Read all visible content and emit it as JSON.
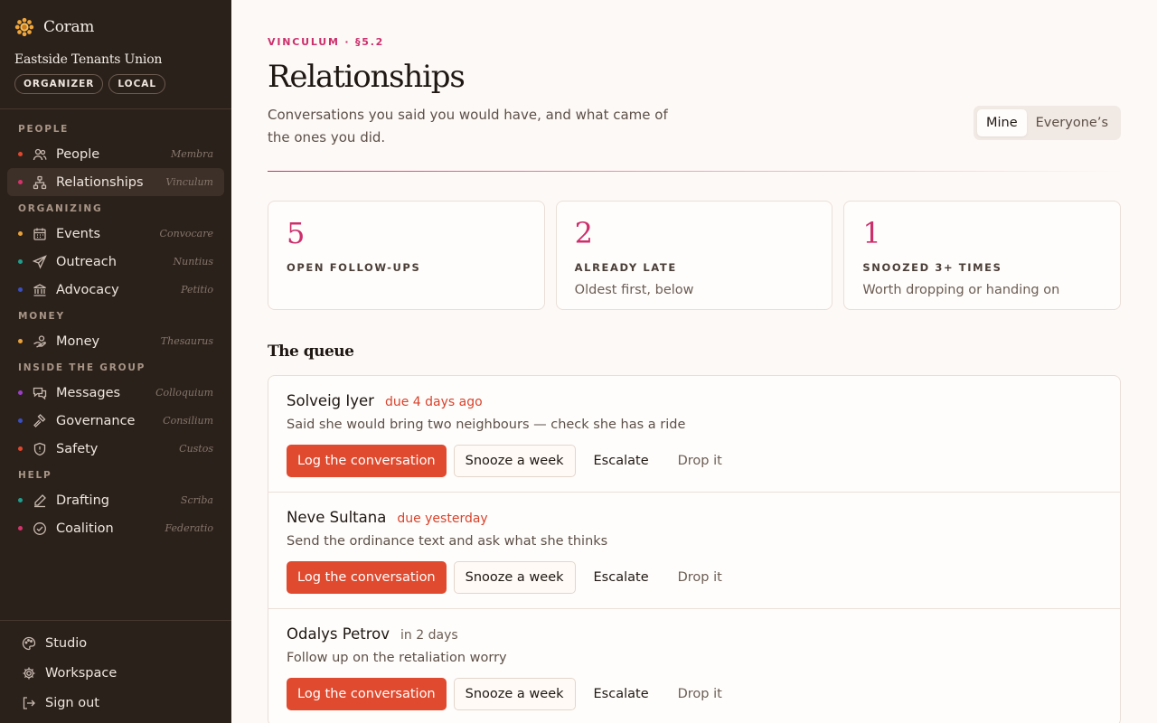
{
  "brand": {
    "name": "Coram"
  },
  "org": {
    "name": "Eastside Tenants Union",
    "badges": [
      "ORGANIZER",
      "LOCAL"
    ]
  },
  "nav": {
    "sections": [
      {
        "title": "PEOPLE",
        "items": [
          {
            "label": "People",
            "latin": "Membra",
            "icon": "people-icon",
            "dot": "#e0482e"
          },
          {
            "label": "Relationships",
            "latin": "Vinculum",
            "icon": "network-icon",
            "dot": "#d6336c",
            "active": true
          }
        ]
      },
      {
        "title": "ORGANIZING",
        "items": [
          {
            "label": "Events",
            "latin": "Convocare",
            "icon": "calendar-icon",
            "dot": "#e9a23b"
          },
          {
            "label": "Outreach",
            "latin": "Nuntius",
            "icon": "send-icon",
            "dot": "#1f9e8e"
          },
          {
            "label": "Advocacy",
            "latin": "Petitio",
            "icon": "building-icon",
            "dot": "#3a4fc0"
          }
        ]
      },
      {
        "title": "MONEY",
        "items": [
          {
            "label": "Money",
            "latin": "Thesaurus",
            "icon": "money-hand-icon",
            "dot": "#e9a23b"
          }
        ]
      },
      {
        "title": "INSIDE THE GROUP",
        "items": [
          {
            "label": "Messages",
            "latin": "Colloquium",
            "icon": "messages-icon",
            "dot": "#9b3fc7"
          },
          {
            "label": "Governance",
            "latin": "Consilium",
            "icon": "gavel-icon",
            "dot": "#3a4fc0"
          },
          {
            "label": "Safety",
            "latin": "Custos",
            "icon": "shield-icon",
            "dot": "#e0482e"
          }
        ]
      },
      {
        "title": "HELP",
        "items": [
          {
            "label": "Drafting",
            "latin": "Scriba",
            "icon": "pen-icon",
            "dot": "#1f9e8e"
          },
          {
            "label": "Coalition",
            "latin": "Federatio",
            "icon": "check-circle-icon",
            "dot": "#d6336c"
          }
        ]
      }
    ]
  },
  "footer": {
    "items": [
      {
        "label": "Studio",
        "icon": "palette-icon"
      },
      {
        "label": "Workspace",
        "icon": "gear-icon"
      },
      {
        "label": "Sign out",
        "icon": "sign-out-icon"
      }
    ]
  },
  "header": {
    "eyebrow": "VINCULUM · §5.2",
    "title": "Relationships",
    "subtitle": "Conversations you said you would have, and what came of the ones you did.",
    "toggle": {
      "options": [
        "Mine",
        "Everyone’s"
      ],
      "selected": "Mine"
    }
  },
  "stats": [
    {
      "value": "5",
      "label": "OPEN FOLLOW-UPS",
      "sub": ""
    },
    {
      "value": "2",
      "label": "ALREADY LATE",
      "sub": "Oldest first, below"
    },
    {
      "value": "1",
      "label": "SNOOZED 3+ TIMES",
      "sub": "Worth dropping or handing on"
    }
  ],
  "queue": {
    "title": "The queue",
    "actions": {
      "log": "Log the conversation",
      "snooze": "Snooze a week",
      "escalate": "Escalate",
      "drop": "Drop it"
    },
    "items": [
      {
        "name": "Solveig Iyer",
        "due": "due 4 days ago",
        "late": true,
        "desc": "Said she would bring two neighbours — check she has a ride"
      },
      {
        "name": "Neve Sultana",
        "due": "due yesterday",
        "late": true,
        "desc": "Send the ordinance text and ask what she thinks"
      },
      {
        "name": "Odalys Petrov",
        "due": "in 2 days",
        "late": false,
        "desc": "Follow up on the retaliation worry"
      }
    ]
  },
  "colors": {
    "accent": "#cc2f6c",
    "primary_button": "#e04a2f",
    "sidebar_bg": "#2b211b",
    "late": "#d8432c"
  }
}
